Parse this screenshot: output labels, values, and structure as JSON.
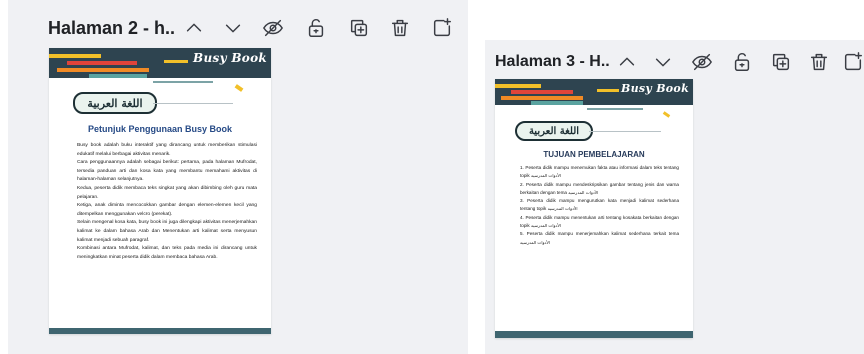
{
  "colors": {
    "panel_bg": "#f0f1f4",
    "banner": "#2e4450",
    "stripe_yellow": "#f2c029",
    "stripe_red": "#e0443a",
    "stripe_orange": "#f08a25",
    "stripe_teal": "#5aa3a0",
    "heading_blue": "#264a86",
    "footer": "#3f6570"
  },
  "toolbar_icons": [
    "chevron-up-icon",
    "chevron-down-icon",
    "eye-hidden-icon",
    "lock-open-icon",
    "duplicate-page-icon",
    "trash-icon",
    "add-page-icon"
  ],
  "page2": {
    "title": "Halaman 2 - h..",
    "brand": "Busy Book",
    "arabic_title": "اللغة العربية",
    "heading": "Petunjuk Penggunaan Busy Book",
    "paragraphs": [
      "Busy book adalah buku interaktif yang dirancang untuk memberikan stimulasi edukatif melalui berbagai aktivitas menarik.",
      "Cara penggunaannya adalah sebagai berikut: pertama, pada halaman Mufrodat, tersedia panduan arti dan kosa kata yang membantu memahami aktivitas di halaman-halaman selanjutnya.",
      "Kedua, peserta didik membaca teks singkat yang akan dibimbing oleh guru mata pelajaran.",
      "Ketiga, anak diminta mencocokkan gambar dengan elemen-elemen kecil yang ditempelkan menggunakan velcro (perekat).",
      "Selain mengenal kosa kata, busy book ini juga dilengkapi aktivitas menerjemahkan kalimat ke dalam bahasa Arab dan Menentukan arti kalimat serta menyusun kalimat menjadi sebuah paragraf.",
      "Kombinasi antara Mufrodat, kalimat, dan teks pada media ini dirancang untuk meningkatkan minat peserta didik dalam membaca bahasa Arab."
    ]
  },
  "page3": {
    "title": "Halaman 3 - H..",
    "brand": "Busy Book",
    "arabic_title": "اللغة العربية",
    "heading": "TUJUAN PEMBELAJARAN",
    "objectives": [
      {
        "text": "1. Peserta didik mampu menemukan fakta atau informasi dalam teks tentang topik",
        "ar": "الأدوات المدرسية"
      },
      {
        "text": "2. Peserta didik mampu mendeskripsikan gambar tentang jenis dan warna berkaitan dengan tema",
        "ar": "الأدوات المدرسية"
      },
      {
        "text": "3. Peserta didik mampu mengurutkan kata menjadi kalimat sederhana tentang topik",
        "ar": "الأدوات المدرسية"
      },
      {
        "text": "4. Peserta didik mampu menentukan arti tentang kosakata berkaitan dengan topik",
        "ar": "الأدوات المدرسية"
      },
      {
        "text": "5. Peserta didik mampu menerjemahkan kalimat sederhana terkait tema",
        "ar": "الأدوات المدرسية"
      }
    ]
  }
}
